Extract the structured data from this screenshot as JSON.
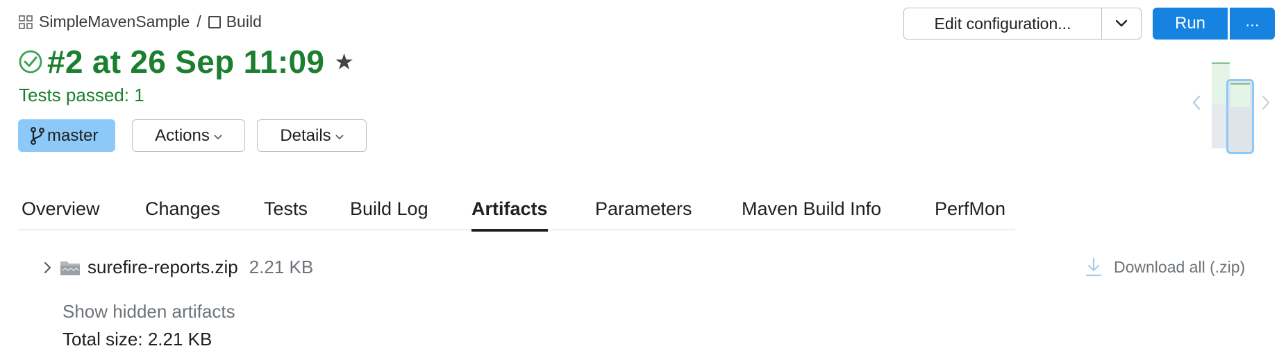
{
  "breadcrumb": {
    "project": "SimpleMavenSample",
    "separator": "/",
    "build_config": "Build"
  },
  "build": {
    "title": "#2 at 26 Sep 11:09",
    "status_text": "Tests passed: 1",
    "branch": "master"
  },
  "buttons": {
    "actions": "Actions",
    "details": "Details",
    "edit_configuration": "Edit configuration...",
    "run": "Run",
    "more": "..."
  },
  "tabs": [
    {
      "label": "Overview",
      "active": false
    },
    {
      "label": "Changes",
      "active": false
    },
    {
      "label": "Tests",
      "active": false
    },
    {
      "label": "Build Log",
      "active": false
    },
    {
      "label": "Artifacts",
      "active": true
    },
    {
      "label": "Parameters",
      "active": false
    },
    {
      "label": "Maven Build Info",
      "active": false
    },
    {
      "label": "PerfMon",
      "active": false
    }
  ],
  "artifacts": {
    "items": [
      {
        "name": "surefire-reports.zip",
        "size": "2.21 KB"
      }
    ],
    "download_all": "Download all (.zip)",
    "show_hidden": "Show hidden artifacts",
    "total_size": "Total size: 2.21 KB"
  },
  "colors": {
    "success_green": "#1a7f2e",
    "primary_blue": "#1683e0",
    "branch_badge": "#8cc8f8"
  }
}
